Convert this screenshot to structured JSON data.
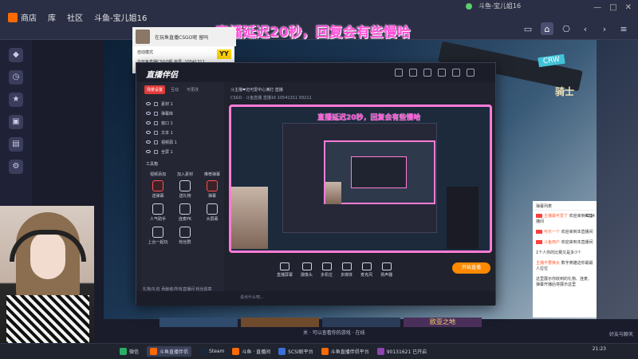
{
  "app": {
    "nav": [
      "商店",
      "库",
      "社区",
      "斗鱼-宝儿姐16"
    ],
    "banner": "直播延迟20秒，回复会有些慢哈",
    "mini_title": "斗鱼-宝儿姐16"
  },
  "overlay": {
    "title": "在玩鱼直播CSGO呢 留吗",
    "assistant_line1": "自动模式",
    "assistant_line2": "在玩鱼直播CSGO呢 房号: 10541311",
    "yy_badge": "YY"
  },
  "companion": {
    "app_name": "直播伴侣",
    "tabs": [
      "场景设置",
      "互动",
      "可更改"
    ],
    "scenes": [
      "素材 1",
      "弹幕库",
      "窗口 1",
      "文本 1",
      "视频源 1",
      "全屏 1"
    ],
    "tools_title": "工具箱",
    "tool_headers": [
      "视频添加",
      "加入素材",
      "推荐弹幕"
    ],
    "tools": [
      {
        "label": "送弹幕",
        "accent": true
      },
      {
        "label": "送礼物",
        "accent": false
      },
      {
        "label": "弹幕",
        "accent": true
      },
      {
        "label": "人气助手",
        "accent": false
      },
      {
        "label": "连麦PK",
        "accent": false
      },
      {
        "label": "大屏幕",
        "accent": false
      },
      {
        "label": "上台一起玩",
        "accent": false
      },
      {
        "label": "粉丝群",
        "accent": false
      }
    ],
    "info_line1": "斗主播❤迈可爱中心满打  直播",
    "info_line2": "CSGO · 斗鱼直播  直播16  10541311  93211",
    "preview_banner": "直播延迟20秒，回复会有些慢哈",
    "bottom_buttons": [
      "直播屏幕",
      "摄像头",
      "多机位",
      "多媒体",
      "麦克风",
      "扬声器"
    ],
    "start_live": "开始直播",
    "footer": "礼物/礼包  贡献者/所有直播间  粉丝勋章",
    "chat_placeholder": "说点什么吧..."
  },
  "chat": {
    "header": "弹幕列表",
    "count": "4214",
    "messages": [
      {
        "name": "主播最可爱了",
        "text": "欢迎来到本直播间"
      },
      {
        "name": "可乐一个",
        "text": "欢迎来到本直播间"
      },
      {
        "name": "斗鱼用户",
        "text": "欢迎来到本直播间"
      },
      {
        "name": "",
        "text": "1个人你的比赛又是多少?"
      },
      {
        "name": "主播不要换太",
        "text": "数字英雄这你最最人拉位"
      },
      {
        "name": "",
        "text": "这里展示你收到的礼物、连麦、弹幕开播后将展示这里"
      }
    ]
  },
  "thumbs": [
    "",
    "",
    "",
    "欧亚之地"
  ],
  "player_line": "关 · 可以查看你的游戏 · 在线",
  "right_label": "好友与聊天",
  "taskbar": {
    "items": [
      {
        "label": "微信",
        "color": "#2aae67",
        "active": false
      },
      {
        "label": "斗鱼直播伴侣",
        "color": "#ff6a00",
        "active": true
      },
      {
        "label": "Steam",
        "color": "#1b2838",
        "active": false
      },
      {
        "label": "斗鱼 · 直播间",
        "color": "#ff6a00",
        "active": false
      },
      {
        "label": "SCSI联平台",
        "color": "#3a6fd8",
        "active": false
      },
      {
        "label": "斗鱼直播伴侣平台",
        "color": "#ff6a00",
        "active": false
      },
      {
        "label": "90131621 已开启",
        "color": "#8e44ad",
        "active": false
      }
    ],
    "clock": "21:23"
  },
  "colors": {
    "accent": "#ff4fd8",
    "brand": "#ff6a00",
    "live_button": "#ff8a00"
  }
}
